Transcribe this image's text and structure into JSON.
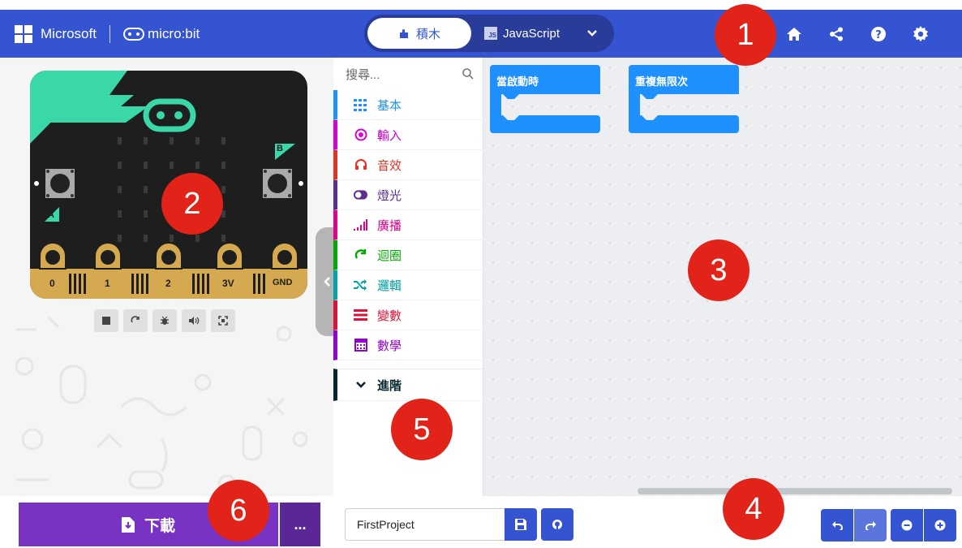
{
  "header": {
    "brand_microsoft": "Microsoft",
    "brand_microbit": "micro:bit",
    "tab_blocks": "積木",
    "tab_javascript": "JavaScript",
    "js_badge": "JS"
  },
  "board": {
    "button_a": "A",
    "button_b": "B",
    "pins": [
      "0",
      "1",
      "2",
      "3V",
      "GND"
    ]
  },
  "toolbox": {
    "search_placeholder": "搜尋...",
    "categories": [
      {
        "label": "基本",
        "color": "#1e90ff"
      },
      {
        "label": "輸入",
        "color": "#d400d4"
      },
      {
        "label": "音效",
        "color": "#e63022"
      },
      {
        "label": "燈光",
        "color": "#5c2d91"
      },
      {
        "label": "廣播",
        "color": "#e3008c"
      },
      {
        "label": "迴圈",
        "color": "#00aa00"
      },
      {
        "label": "邏輯",
        "color": "#00a4a6"
      },
      {
        "label": "變數",
        "color": "#dc143c"
      },
      {
        "label": "數學",
        "color": "#9400d3"
      },
      {
        "label": "進階",
        "color": "#06262d"
      }
    ]
  },
  "workspace": {
    "block_on_start": "當啟動時",
    "block_forever": "重複無限次",
    "block_color": "#1e90ff"
  },
  "footer": {
    "download_label": "下載",
    "more_label": "...",
    "project_name": "FirstProject"
  },
  "markers": [
    "1",
    "2",
    "3",
    "4",
    "5",
    "6"
  ],
  "colors": {
    "header_bg": "#3454d1",
    "download_bg": "#7933c2",
    "marker_red": "#e2231a"
  }
}
